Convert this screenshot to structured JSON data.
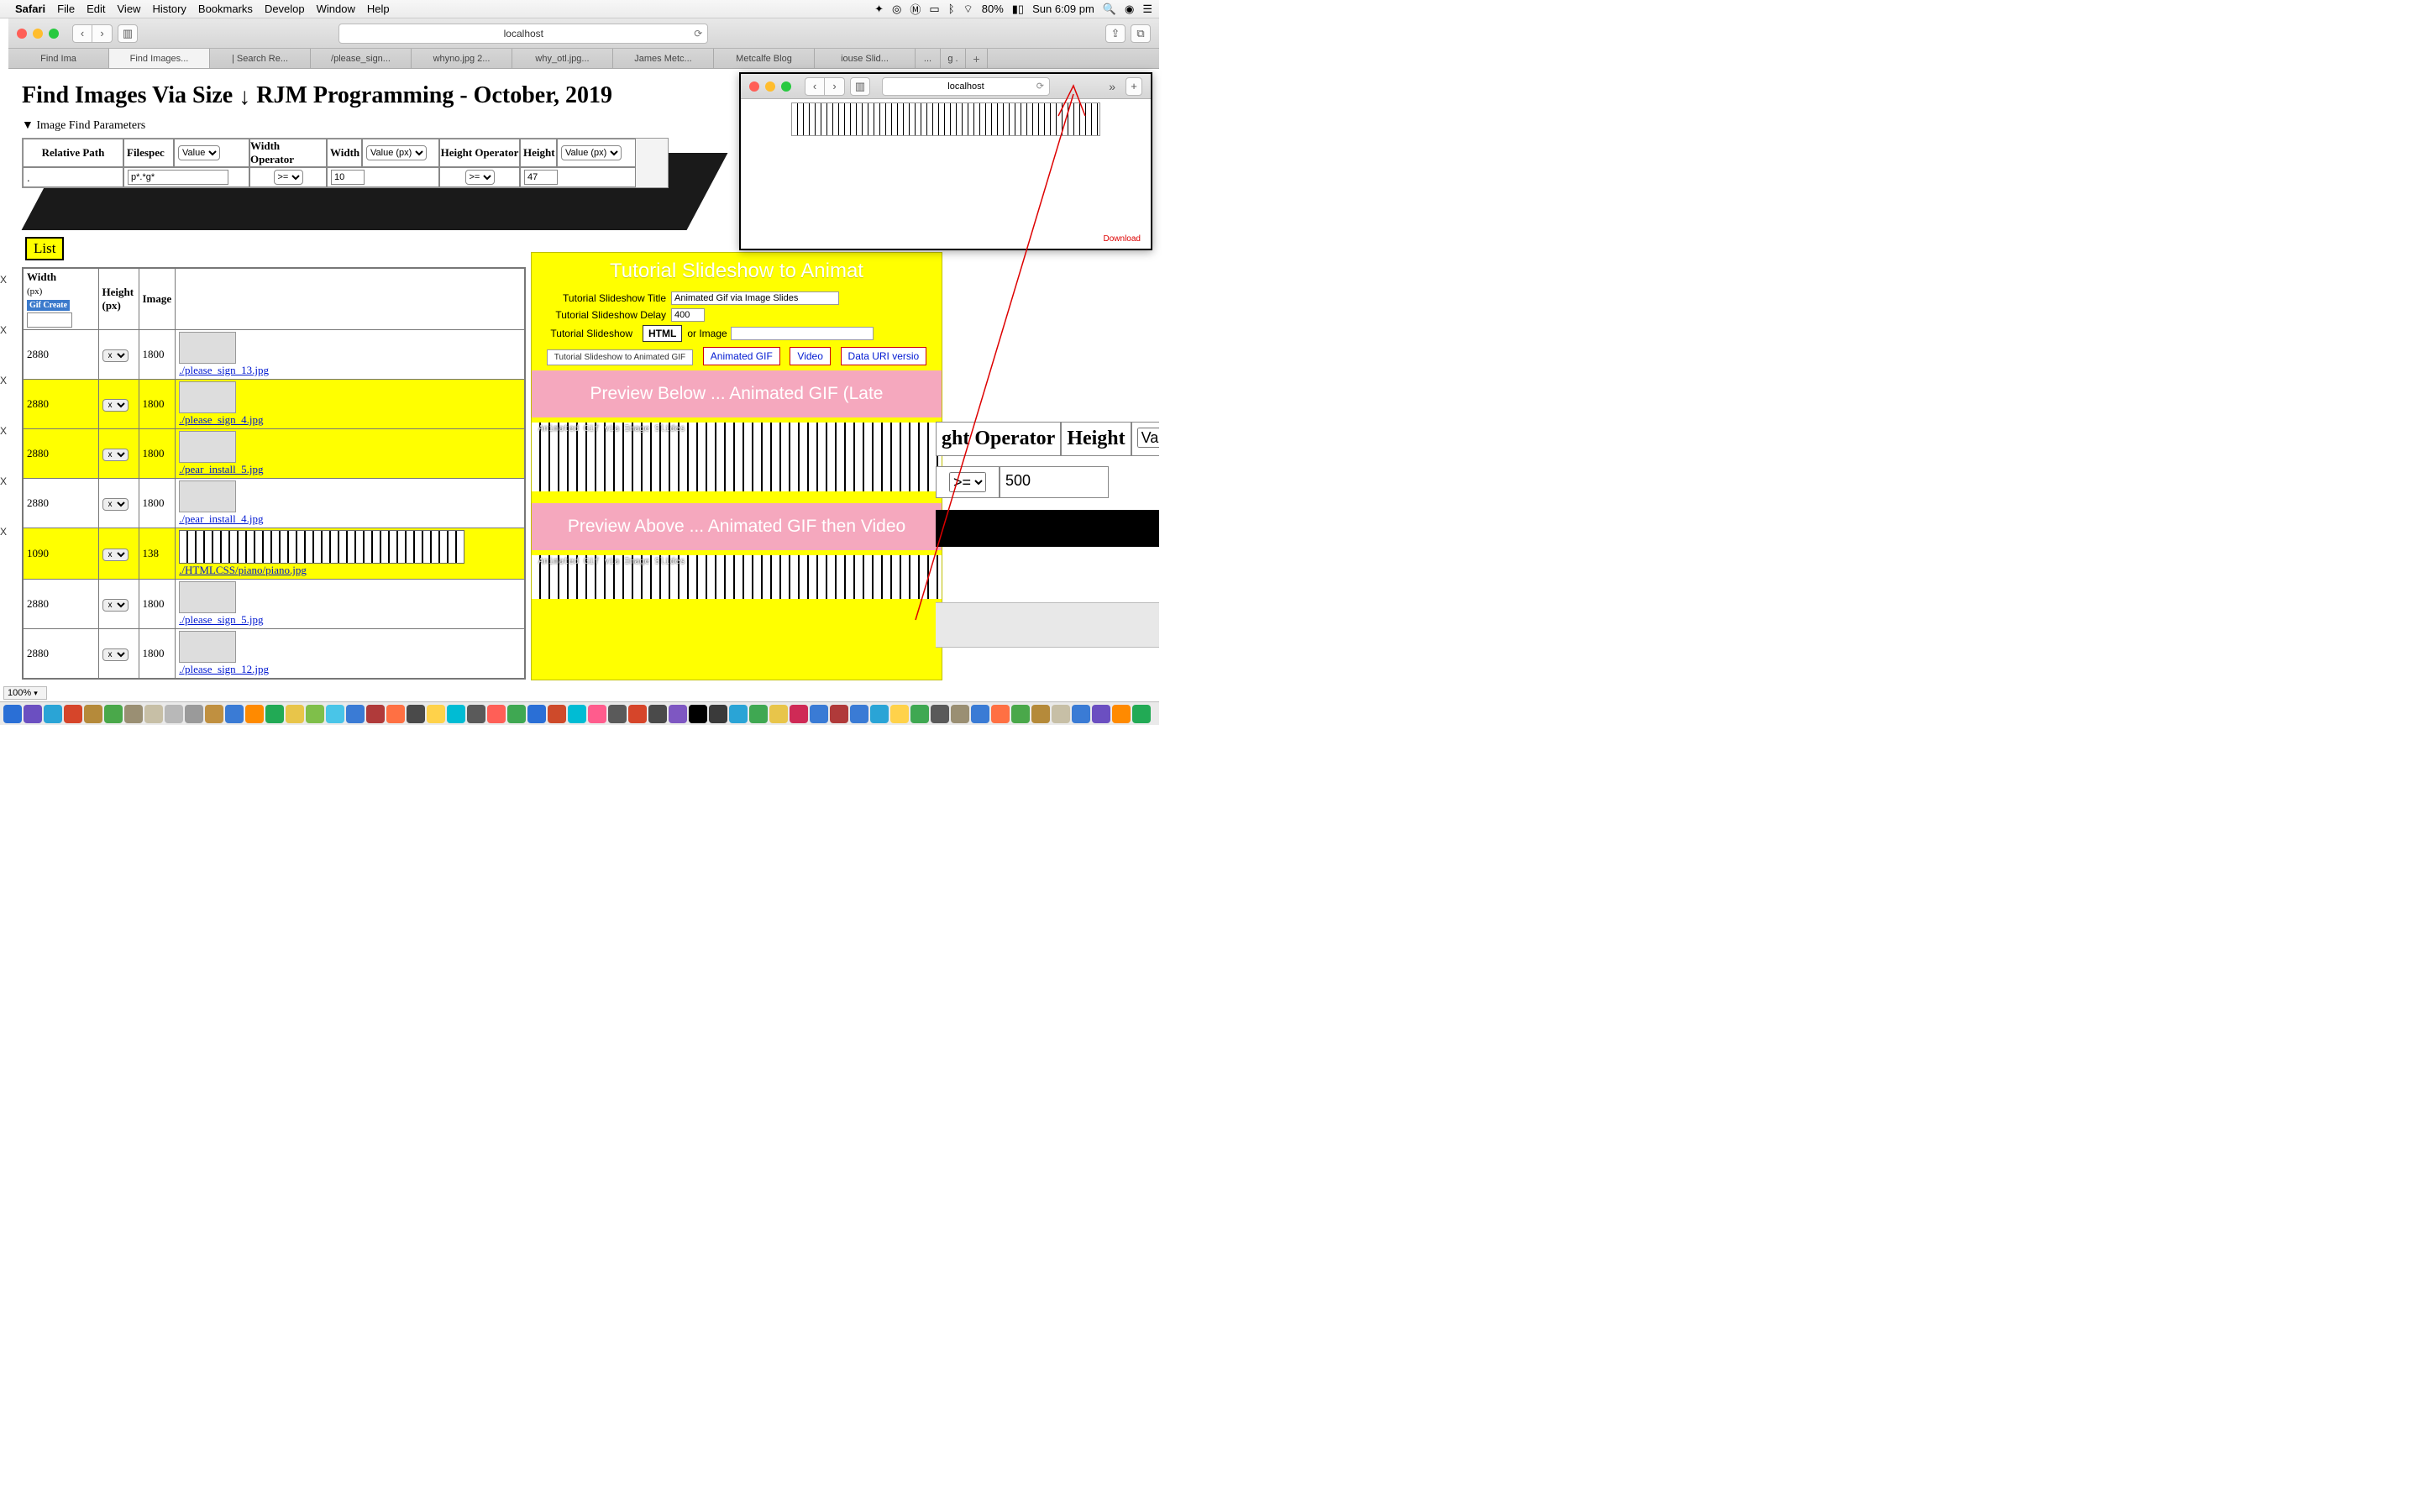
{
  "menubar": {
    "app": "Safari",
    "items": [
      "File",
      "Edit",
      "View",
      "History",
      "Bookmarks",
      "Develop",
      "Window",
      "Help"
    ],
    "battery": "80%",
    "clock": "Sun 6:09 pm"
  },
  "browser": {
    "url": "localhost",
    "tabs": [
      "Find Ima",
      "Find Images...",
      "| Search Re...",
      "/please_sign...",
      "whyno.jpg 2...",
      "why_otl.jpg...",
      "James Metc...",
      "Metcalfe Blog",
      "iouse Slid...",
      "...",
      "g ."
    ]
  },
  "page": {
    "title_prefix": "Find Images Via Size ",
    "title_suffix": " RJM Programming - October, 2019",
    "details_label": "Image Find Parameters",
    "params": {
      "headers": [
        "Relative Path",
        "Filespec",
        "Width Operator",
        "Width",
        "Height Operator",
        "Height"
      ],
      "filespec_sel": "Value",
      "width_sel": "Value (px)",
      "height_sel": "Value (px)",
      "relpath_val": ".",
      "filespec_val": "p*.*g*",
      "wop": ">=",
      "width_val": "10",
      "hop": ">=",
      "height_val": "47"
    },
    "list_label": "List",
    "table": {
      "th_width": "Width",
      "th_px": "(px)",
      "th_gif": "Gif Create",
      "th_height": "Height (px)",
      "th_image": "Image",
      "rows": [
        {
          "w": "2880",
          "h": "1800",
          "link": "./please_sign_13.jpg",
          "hl": false
        },
        {
          "w": "2880",
          "h": "1800",
          "link": "./please_sign_4.jpg",
          "hl": true
        },
        {
          "w": "2880",
          "h": "1800",
          "link": "./pear_install_5.jpg",
          "hl": true
        },
        {
          "w": "2880",
          "h": "1800",
          "link": "./pear_install_4.jpg",
          "hl": false
        },
        {
          "w": "1090",
          "h": "138",
          "link": "./HTMLCSS/piano/piano.jpg",
          "hl": true,
          "piano": true
        },
        {
          "w": "2880",
          "h": "1800",
          "link": "./please_sign_5.jpg",
          "hl": false
        },
        {
          "w": "2880",
          "h": "1800",
          "link": "./please_sign_12.jpg",
          "hl": false
        }
      ],
      "xsel": "x"
    }
  },
  "slideshow": {
    "heading": "Tutorial Slideshow to Animat",
    "title_label": "Tutorial Slideshow Title",
    "title_val": "Animated Gif via Image Slides",
    "delay_label": "Tutorial Slideshow Delay",
    "delay_val": "400",
    "mode_label": "Tutorial Slideshow",
    "mode_btn": "HTML",
    "mode_or": "or Image",
    "btns_plain": "Tutorial Slideshow to Animated GIF",
    "btn_animgif": "Animated GIF",
    "btn_video": "Video",
    "btn_datauri": "Data URI versio",
    "preview_below": "Preview Below ... Animated GIF (Late",
    "preview_above": "Preview Above ... Animated GIF then Video",
    "caption": "Animated Gif via Image Slides"
  },
  "miniwin": {
    "url": "localhost",
    "download": "Download",
    "chevrons": "»"
  },
  "bgright": {
    "h1": "ght Operator",
    "h2": "Height",
    "valu": "Valu",
    "op": ">=",
    "val": "500"
  },
  "zoom": "100%",
  "dock_colors": [
    "#2a6fd6",
    "#6b4fc1",
    "#2aa4d6",
    "#d6452a",
    "#b58a3a",
    "#4aa84a",
    "#9a8f73",
    "#c7bfa6",
    "#b8b8b8",
    "#9a9a9a",
    "#c09040",
    "#3a7bd5",
    "#ff8a00",
    "#22aa55",
    "#e8c54a",
    "#7fbf4a",
    "#49c5e8",
    "#3a7bd5",
    "#b03a3a",
    "#ff7043",
    "#4a4a4a",
    "#ffd24a",
    "#00bcd4",
    "#5a5a5a",
    "#ff5f57",
    "#3fa852",
    "#2a6fd6",
    "#ce4a2a",
    "#00bcd4",
    "#ff5c8d",
    "#5a5a5a",
    "#d6452a",
    "#4a4a4a",
    "#7e57c2",
    "#000",
    "#3a3a3a",
    "#2aa4d6",
    "#3fa852",
    "#e8c54a",
    "#cf2a56",
    "#3a7bd5",
    "#b03a3a",
    "#3a7bd5",
    "#2aa4d6",
    "#ffd24a",
    "#3fa852",
    "#5a5a5a",
    "#9a8f73",
    "#3a7bd5",
    "#ff7043",
    "#4aa84a",
    "#b58a3a",
    "#c7bfa6",
    "#3a7bd5",
    "#6b4fc1",
    "#ff8a00",
    "#22aa55"
  ]
}
